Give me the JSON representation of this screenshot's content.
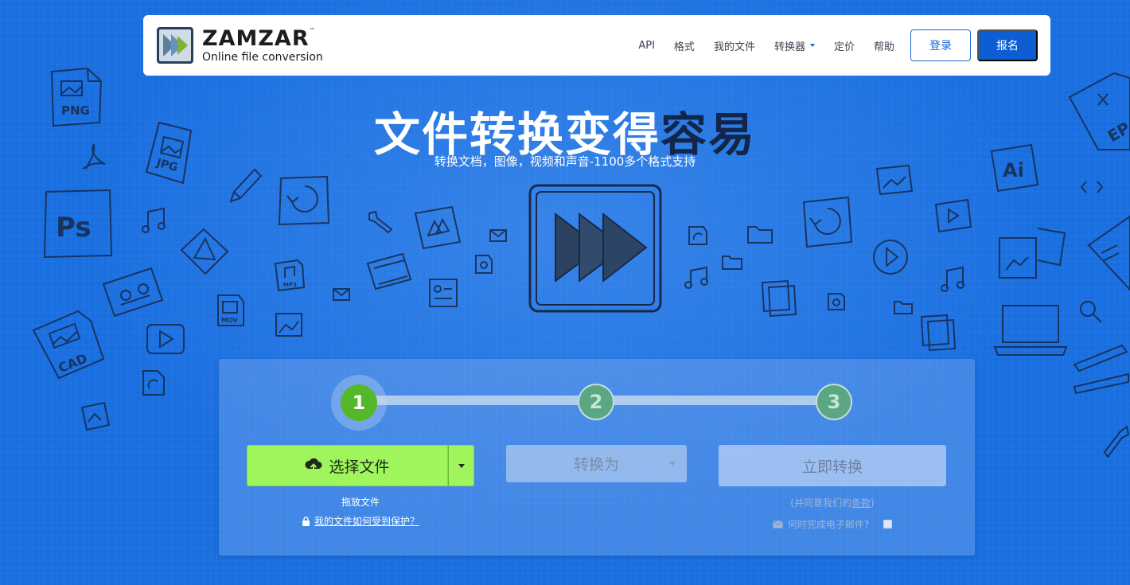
{
  "header": {
    "logo_name": "ZAMZAR",
    "logo_tm": "™",
    "logo_tagline": "Online file conversion",
    "nav": [
      {
        "label": "API"
      },
      {
        "label": "格式"
      },
      {
        "label": "我的文件"
      },
      {
        "label": "转换器",
        "has_dropdown": true
      },
      {
        "label": "定价"
      },
      {
        "label": "帮助"
      }
    ],
    "login_label": "登录",
    "signup_label": "报名"
  },
  "hero": {
    "title_main": "文件转换变得",
    "title_accent": "容易",
    "subtitle": "转换文档，图像，视频和声音-1100多个格式支持"
  },
  "converter": {
    "steps": [
      "1",
      "2",
      "3"
    ],
    "choose_files_label": "选择文件",
    "drop_hint": "拖放文件",
    "protect_link": "我的文件如何受到保护？",
    "convert_to_label": "转换为",
    "convert_now_label": "立即转换",
    "terms_prefix": "(并同意我们的",
    "terms_link": "条款",
    "terms_suffix": ")",
    "email_prompt": "何时完成电子邮件?"
  },
  "deco_labels": {
    "png": "PNG",
    "jpg": "JPG",
    "ps": "Ps",
    "cad": "CAD",
    "ai": "Ai",
    "ep": "EP",
    "mov": "MOV",
    "mp3": "MP3"
  },
  "colors": {
    "background": "#1a6fe0",
    "primary_button": "#0d5ed3",
    "choose_button": "#9ff55b",
    "step_active": "#55b82a",
    "title_accent": "#12254a"
  }
}
